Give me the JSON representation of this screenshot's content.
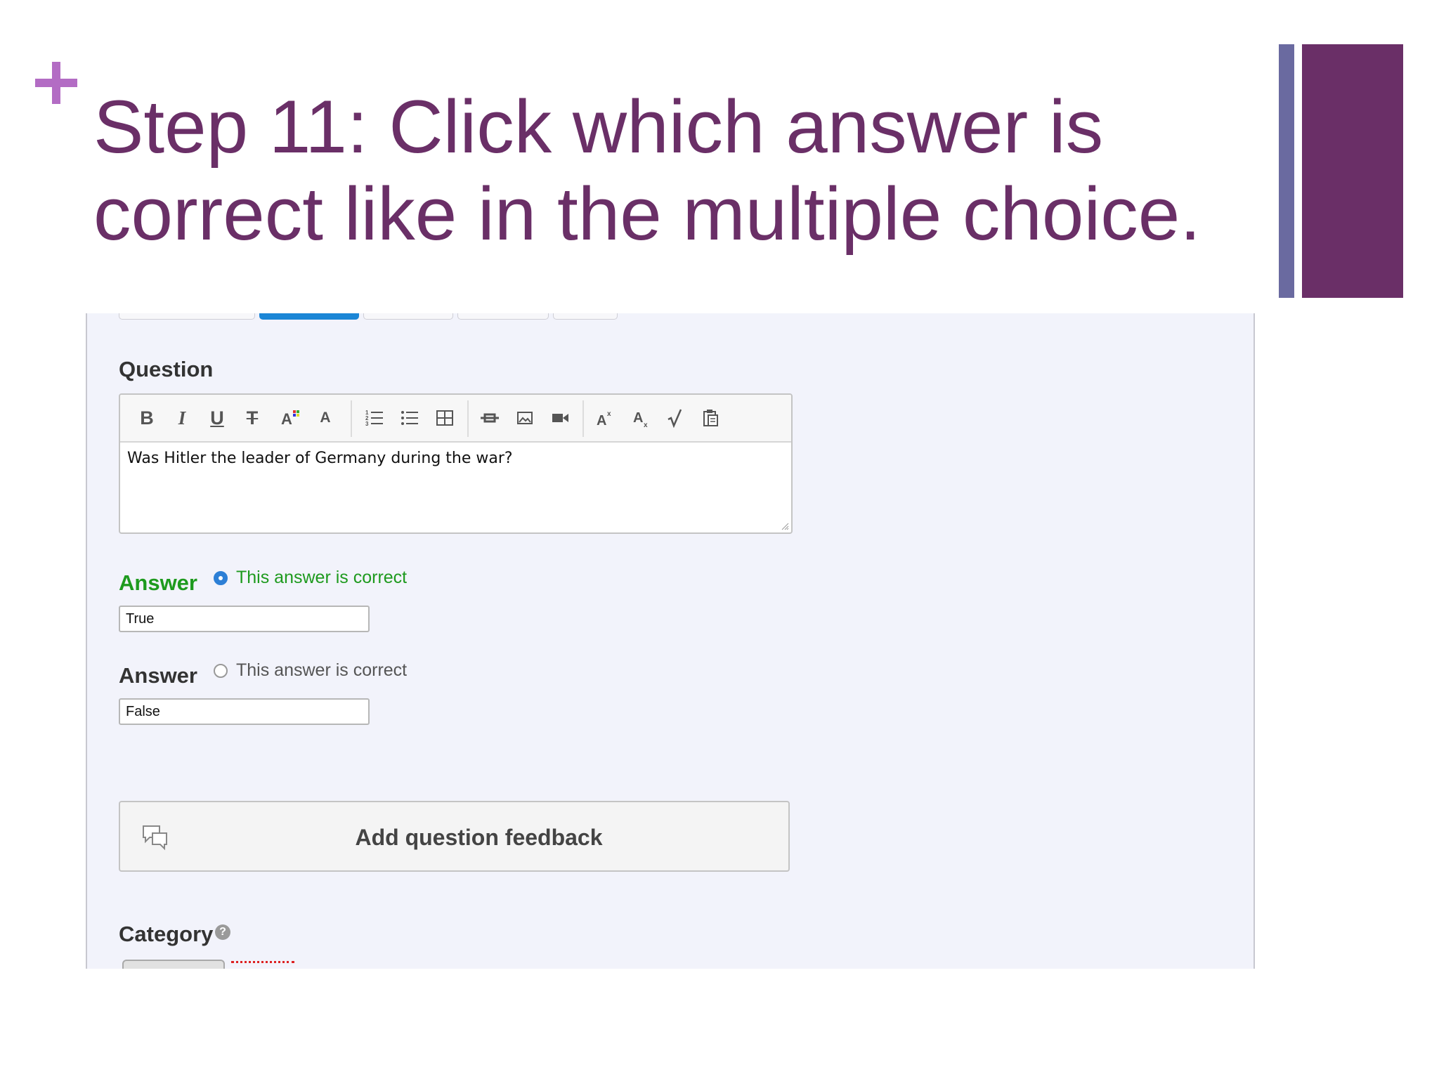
{
  "slide": {
    "title": "Step 11: Click which answer is correct like in the multiple choice."
  },
  "question": {
    "label": "Question",
    "text": "Was Hitler the leader of Germany during the war?",
    "toolbar_icons": [
      "bold-icon",
      "italic-icon",
      "underline-icon",
      "strikethrough-icon",
      "font-color-icon",
      "font-size-icon",
      "ordered-list-icon",
      "unordered-list-icon",
      "table-icon",
      "embed-icon",
      "image-icon",
      "video-icon",
      "superscript-icon",
      "subscript-icon",
      "math-icon",
      "paste-icon"
    ]
  },
  "answers": [
    {
      "label": "Answer",
      "radio_text": "This answer is correct",
      "value": "True",
      "checked": true
    },
    {
      "label": "Answer",
      "radio_text": "This answer is correct",
      "value": "False",
      "checked": false
    }
  ],
  "feedback": {
    "label": "Add question feedback"
  },
  "category": {
    "label": "Category",
    "help": "?"
  },
  "colors": {
    "title": "#6a2f67",
    "accent_plus": "#b36cc4",
    "correct_green": "#1e9a1e",
    "tab_active": "#1b86d6",
    "bar_thin": "#6a6aa0",
    "bar_thick": "#6a2f67"
  }
}
